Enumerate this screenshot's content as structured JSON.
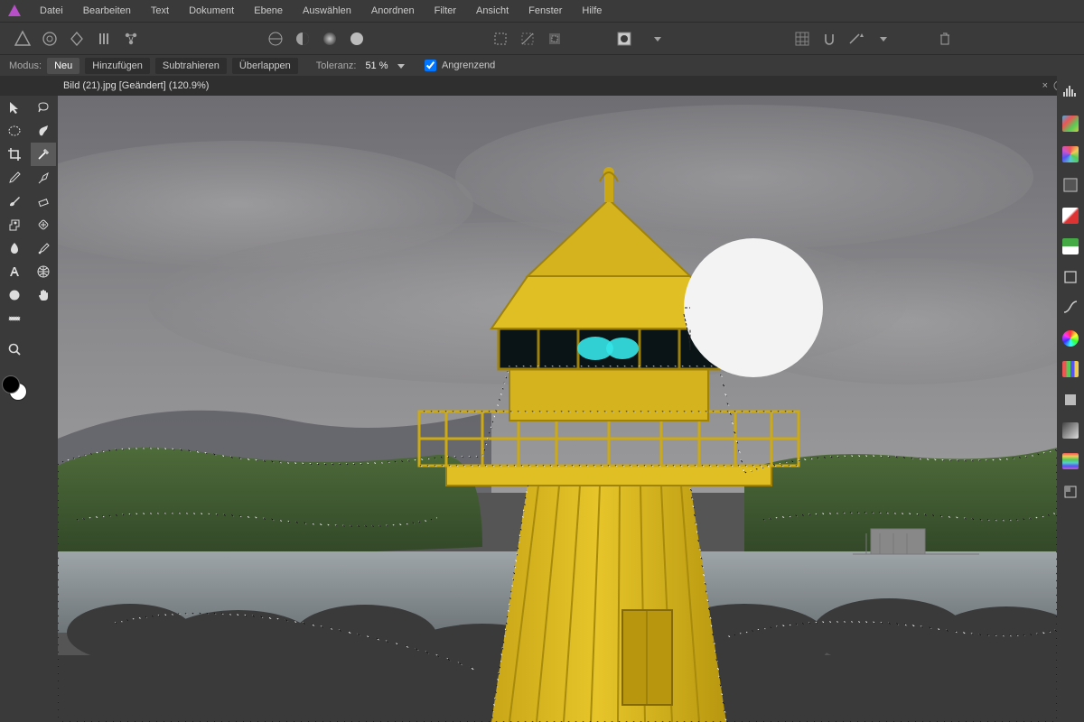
{
  "menu": {
    "items": [
      "Datei",
      "Bearbeiten",
      "Text",
      "Dokument",
      "Ebene",
      "Auswählen",
      "Anordnen",
      "Filter",
      "Ansicht",
      "Fenster",
      "Hilfe"
    ]
  },
  "optbar": {
    "modus_label": "Modus:",
    "modes": [
      "Neu",
      "Hinzufügen",
      "Subtrahieren",
      "Überlappen"
    ],
    "active_mode_index": 0,
    "toleranz_label": "Toleranz:",
    "toleranz_value": "51 %",
    "angrenzend_label": "Angrenzend",
    "angrenzend_checked": true
  },
  "document": {
    "tab_title": "Bild (21).jpg [Geändert] (120.9%)"
  },
  "tools_left": [
    "move-tool",
    "marquee-rect-tool",
    "crop-tool",
    "color-picker-tool",
    "paintbrush-tool",
    "clone-tool",
    "dropper-tool",
    "text-tool",
    "circle-tool",
    "gradient-tool",
    "zoom-tool"
  ],
  "tools_right": [
    "lasso-tool",
    "smudge-tool",
    "flood-select-tool",
    "pen-tool",
    "eraser-tool",
    "heal-tool",
    "blur-tool",
    "mesh-tool",
    "pan-tool"
  ],
  "active_tool": "flood-select-tool",
  "right_panels": [
    {
      "name": "histogram-icon",
      "color": "#ccc"
    },
    {
      "name": "color-icon",
      "bg": "linear-gradient(135deg,#f00,#0f0,#00f)"
    },
    {
      "name": "swatches-icon",
      "bg": "conic-gradient(#f44,#4f4,#44f,#ff4,#f4f,#4ff,#f44)"
    },
    {
      "name": "adjustment-icon",
      "color": "#ccc"
    },
    {
      "name": "channels-r-icon",
      "bg": "linear-gradient(135deg,#fff,#d22)"
    },
    {
      "name": "channels-g-icon",
      "bg": "linear-gradient(135deg,#3c3,#fff)"
    },
    {
      "name": "effects-icon",
      "color": "#ccc"
    },
    {
      "name": "curve-icon",
      "color": "#ccc"
    },
    {
      "name": "wheel-icon",
      "bg": "conic-gradient(#f00,#ff0,#0f0,#0ff,#00f,#f0f,#f00)"
    },
    {
      "name": "palette-icon",
      "bg": "linear-gradient(90deg,#f44,#4f4,#44f,#ff4)"
    },
    {
      "name": "layers-icon",
      "color": "#ccc"
    },
    {
      "name": "gradient-panel-icon",
      "bg": "linear-gradient(135deg,#555,#ccc)"
    },
    {
      "name": "rainbow-icon",
      "bg": "linear-gradient(180deg,#f44,#ff4,#4f4,#4ff,#44f,#f4f)"
    },
    {
      "name": "assets-icon",
      "color": "#ccc"
    }
  ],
  "colors": {
    "foreground": "#000000",
    "background": "#ffffff"
  }
}
